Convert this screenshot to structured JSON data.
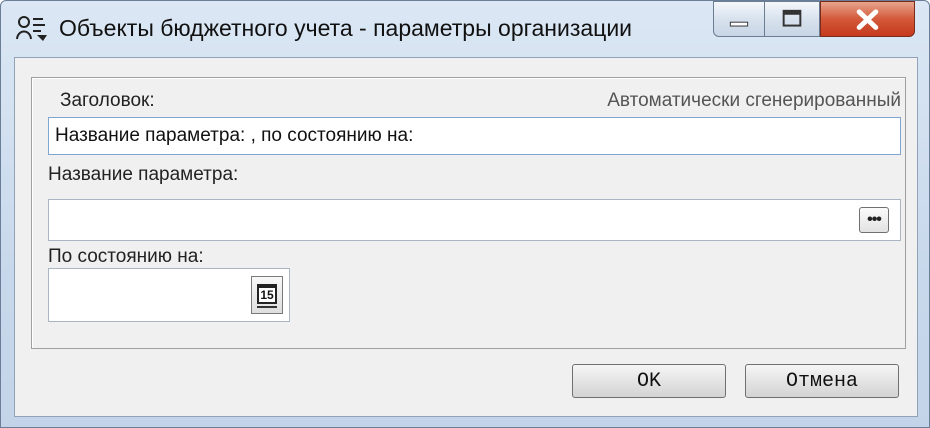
{
  "window": {
    "title": "Объекты бюджетного учета - параметры организации",
    "controls": {
      "minimize": "minimize",
      "maximize": "maximize",
      "close": "close"
    }
  },
  "form": {
    "heading_label": "Заголовок:",
    "heading_hint": "Автоматически сгенерированный",
    "heading_value": "Название параметра: , по состоянию на:",
    "param_label": "Название параметра:",
    "param_value": "",
    "param_button": "•••",
    "date_label": "По состоянию на:",
    "date_value": "",
    "calendar_day": "15"
  },
  "buttons": {
    "ok": "OK",
    "cancel": "Отмена"
  },
  "icons": {
    "app": "app-person-icon",
    "calendar": "calendar-icon",
    "ellipsis": "ellipsis-icon"
  }
}
